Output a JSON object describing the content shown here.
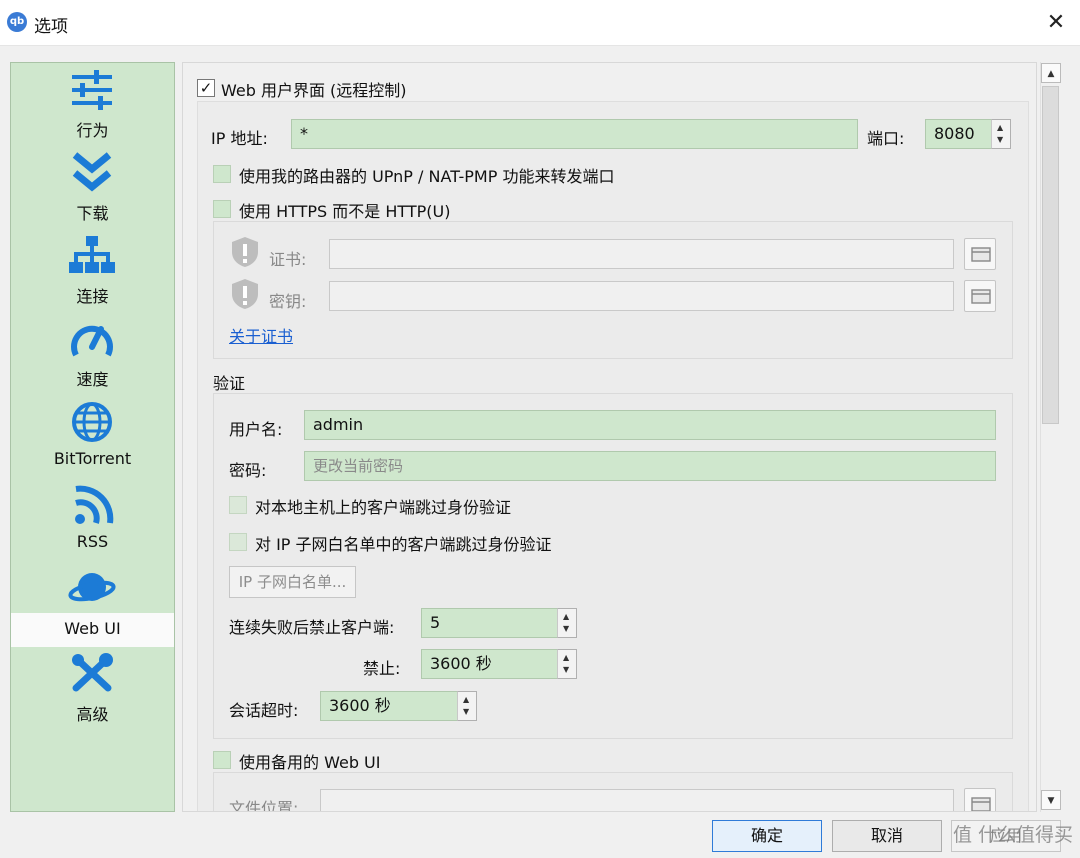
{
  "window": {
    "app_icon_text": "qb",
    "title": "选项",
    "close_glyph": "✕"
  },
  "sidebar": {
    "items": [
      {
        "label": "行为",
        "icon": "sliders-icon"
      },
      {
        "label": "下载",
        "icon": "double-chevron-down-icon"
      },
      {
        "label": "连接",
        "icon": "network-icon"
      },
      {
        "label": "速度",
        "icon": "speedometer-icon"
      },
      {
        "label": "BitTorrent",
        "icon": "globe-icon"
      },
      {
        "label": "RSS",
        "icon": "rss-icon"
      },
      {
        "label": "Web UI",
        "icon": "planet-icon",
        "active": true
      },
      {
        "label": "高级",
        "icon": "tools-icon"
      }
    ]
  },
  "webui": {
    "enable_label": "Web 用户界面 (远程控制)",
    "enable_checked": true,
    "ip_label": "IP 地址:",
    "ip_value": "*",
    "port_label": "端口:",
    "port_value": "8080",
    "upnp_label": "使用我的路由器的 UPnP / NAT-PMP 功能来转发端口",
    "https_label": "使用 HTTPS 而不是 HTTP(U)",
    "cert_label": "证书:",
    "key_label": "密钥:",
    "about_cert_link": "关于证书"
  },
  "auth": {
    "section_label": "验证",
    "username_label": "用户名:",
    "username_value": "admin",
    "password_label": "密码:",
    "password_placeholder": "更改当前密码",
    "bypass_local_label": "对本地主机上的客户端跳过身份验证",
    "bypass_subnet_label": "对 IP 子网白名单中的客户端跳过身份验证",
    "subnet_button": "IP 子网白名单...",
    "ban_after_label": "连续失败后禁止客户端:",
    "ban_after_value": "5",
    "ban_label": "禁止:",
    "ban_value": "3600 秒",
    "session_timeout_label": "会话超时:",
    "session_timeout_value": "3600 秒"
  },
  "alt_webui": {
    "label": "使用备用的 Web UI",
    "file_location_label": "文件位置:"
  },
  "buttons": {
    "ok": "确定",
    "cancel": "取消",
    "apply": "应用"
  },
  "watermark": "值 什么值得买",
  "colors": {
    "field_green": "#cfe7cd",
    "link_blue": "#1a5fd1",
    "primary_border": "#2f7bd8"
  }
}
